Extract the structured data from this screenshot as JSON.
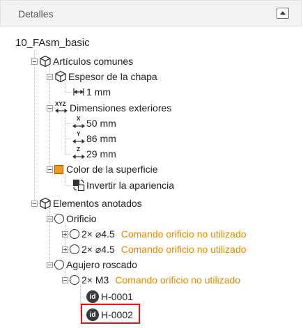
{
  "header": {
    "title": "Detalles"
  },
  "tree": {
    "root": "10_FAsm_basic",
    "common": {
      "label": "Artículos comunes",
      "thickness": {
        "label": "Espesor de la chapa",
        "value": "1 mm"
      },
      "dimensions": {
        "label": "Dimensiones exteriores",
        "icon_text": "XYZ",
        "x": {
          "axis": "X",
          "value": "50 mm"
        },
        "y": {
          "axis": "Y",
          "value": "86 mm"
        },
        "z": {
          "axis": "Z",
          "value": "29 mm"
        }
      },
      "color": {
        "label": "Color de la superficie",
        "swatch": "#f29a1e",
        "invert": "Invertir la apariencia"
      }
    },
    "annotated": {
      "label": "Elementos anotados",
      "hole": {
        "label": "Orificio",
        "items": [
          {
            "text": "2× ⌀4.5",
            "warning": "Comando orificio no utilizado"
          },
          {
            "text": "2× ⌀4.5",
            "warning": "Comando orificio no utilizado"
          }
        ]
      },
      "tapped": {
        "label": "Agujero roscado",
        "item": {
          "text": "2× M3",
          "warning": "Comando orificio no utilizado"
        },
        "ids": [
          "H-0001",
          "H-0002"
        ],
        "id_badge": "id"
      }
    }
  },
  "colors": {
    "warning": "#e08a00",
    "highlight": "#e0121a"
  }
}
